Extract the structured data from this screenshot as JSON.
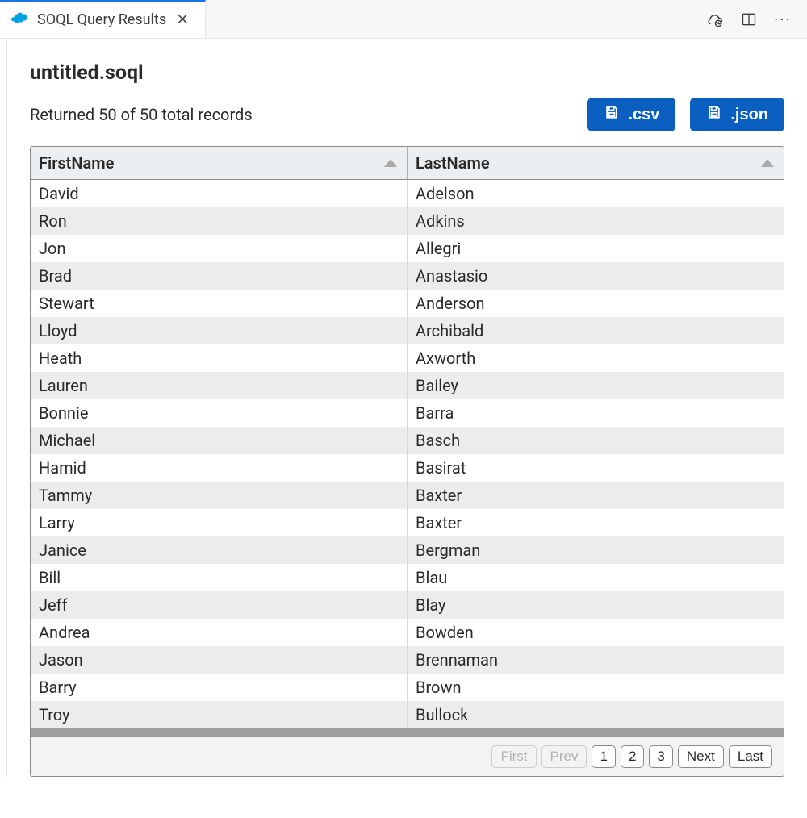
{
  "tab": {
    "title": "SOQL Query Results"
  },
  "page_title": "untitled.soql",
  "record_count_text": "Returned 50 of 50 total records",
  "export": {
    "csv_label": ".csv",
    "json_label": ".json"
  },
  "columns": {
    "first": "FirstName",
    "last": "LastName"
  },
  "rows": [
    {
      "first": "David",
      "last": "Adelson"
    },
    {
      "first": "Ron",
      "last": "Adkins"
    },
    {
      "first": "Jon",
      "last": "Allegri"
    },
    {
      "first": "Brad",
      "last": "Anastasio"
    },
    {
      "first": "Stewart",
      "last": "Anderson"
    },
    {
      "first": "Lloyd",
      "last": "Archibald"
    },
    {
      "first": "Heath",
      "last": "Axworth"
    },
    {
      "first": "Lauren",
      "last": "Bailey"
    },
    {
      "first": "Bonnie",
      "last": "Barra"
    },
    {
      "first": "Michael",
      "last": "Basch"
    },
    {
      "first": "Hamid",
      "last": "Basirat"
    },
    {
      "first": "Tammy",
      "last": "Baxter"
    },
    {
      "first": "Larry",
      "last": "Baxter"
    },
    {
      "first": "Janice",
      "last": "Bergman"
    },
    {
      "first": "Bill",
      "last": "Blau"
    },
    {
      "first": "Jeff",
      "last": "Blay"
    },
    {
      "first": "Andrea",
      "last": "Bowden"
    },
    {
      "first": "Jason",
      "last": "Brennaman"
    },
    {
      "first": "Barry",
      "last": "Brown"
    },
    {
      "first": "Troy",
      "last": "Bullock"
    }
  ],
  "pager": {
    "first": "First",
    "prev": "Prev",
    "pages": [
      "1",
      "2",
      "3"
    ],
    "next": "Next",
    "last": "Last"
  }
}
